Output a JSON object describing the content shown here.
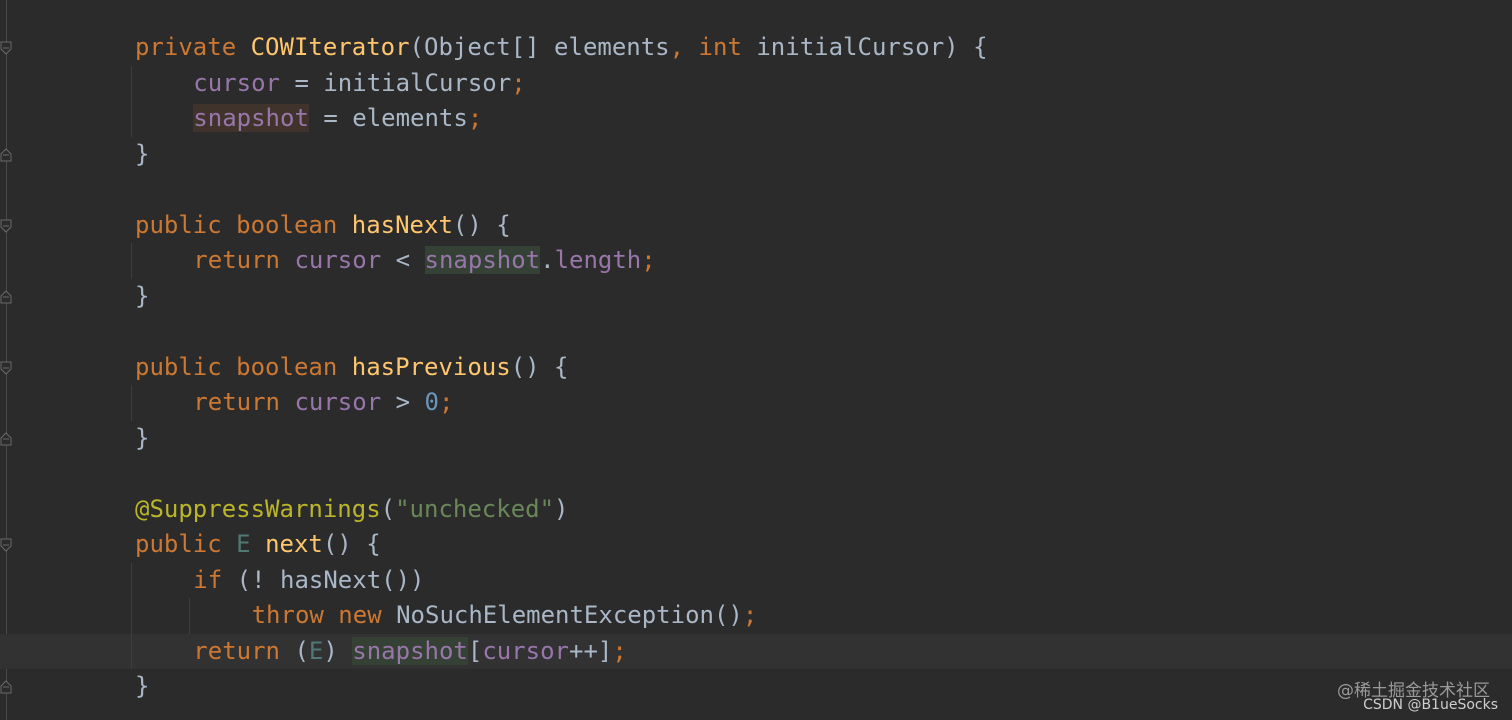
{
  "editor": {
    "lines": [
      {
        "indent": 0,
        "tokens": [
          {
            "t": "private ",
            "c": "kw"
          },
          {
            "t": "COWIterator",
            "c": "fn"
          },
          {
            "t": "(Object[] elements",
            "c": ""
          },
          {
            "t": ", ",
            "c": "kw"
          },
          {
            "t": "int ",
            "c": "kw"
          },
          {
            "t": "initialCursor) {",
            "c": ""
          }
        ]
      },
      {
        "indent": 1,
        "tokens": [
          {
            "t": "cursor",
            "c": "field"
          },
          {
            "t": " = initialCursor",
            "c": ""
          },
          {
            "t": ";",
            "c": "kw"
          }
        ]
      },
      {
        "indent": 1,
        "tokens": [
          {
            "t": "snapshot",
            "c": "field hl-write"
          },
          {
            "t": " = elements",
            "c": ""
          },
          {
            "t": ";",
            "c": "kw"
          }
        ]
      },
      {
        "indent": 0,
        "tokens": [
          {
            "t": "}",
            "c": ""
          }
        ]
      },
      {
        "indent": 0,
        "tokens": []
      },
      {
        "indent": 0,
        "tokens": [
          {
            "t": "public ",
            "c": "kw"
          },
          {
            "t": "boolean ",
            "c": "kw"
          },
          {
            "t": "hasNext",
            "c": "fn"
          },
          {
            "t": "() {",
            "c": ""
          }
        ]
      },
      {
        "indent": 1,
        "tokens": [
          {
            "t": "return ",
            "c": "kw"
          },
          {
            "t": "cursor",
            "c": "field"
          },
          {
            "t": " < ",
            "c": ""
          },
          {
            "t": "snapshot",
            "c": "field hl-read"
          },
          {
            "t": ".",
            "c": ""
          },
          {
            "t": "length",
            "c": "field"
          },
          {
            "t": ";",
            "c": "kw"
          }
        ]
      },
      {
        "indent": 0,
        "tokens": [
          {
            "t": "}",
            "c": ""
          }
        ]
      },
      {
        "indent": 0,
        "tokens": []
      },
      {
        "indent": 0,
        "tokens": [
          {
            "t": "public ",
            "c": "kw"
          },
          {
            "t": "boolean ",
            "c": "kw"
          },
          {
            "t": "hasPrevious",
            "c": "fn"
          },
          {
            "t": "() {",
            "c": ""
          }
        ]
      },
      {
        "indent": 1,
        "tokens": [
          {
            "t": "return ",
            "c": "kw"
          },
          {
            "t": "cursor",
            "c": "field"
          },
          {
            "t": " > ",
            "c": ""
          },
          {
            "t": "0",
            "c": "num"
          },
          {
            "t": ";",
            "c": "kw"
          }
        ]
      },
      {
        "indent": 0,
        "tokens": [
          {
            "t": "}",
            "c": ""
          }
        ]
      },
      {
        "indent": 0,
        "tokens": []
      },
      {
        "indent": 0,
        "tokens": [
          {
            "t": "@SuppressWarnings",
            "c": "ann"
          },
          {
            "t": "(",
            "c": ""
          },
          {
            "t": "\"unchecked\"",
            "c": "str"
          },
          {
            "t": ")",
            "c": ""
          }
        ]
      },
      {
        "indent": 0,
        "tokens": [
          {
            "t": "public ",
            "c": "kw"
          },
          {
            "t": "E",
            "c": "tparam"
          },
          {
            "t": " ",
            "c": ""
          },
          {
            "t": "next",
            "c": "fn"
          },
          {
            "t": "() {",
            "c": ""
          }
        ]
      },
      {
        "indent": 1,
        "tokens": [
          {
            "t": "if ",
            "c": "kw"
          },
          {
            "t": "(! hasNext())",
            "c": ""
          }
        ]
      },
      {
        "indent": 2,
        "tokens": [
          {
            "t": "throw new ",
            "c": "kw"
          },
          {
            "t": "NoSuchElementException()",
            "c": ""
          },
          {
            "t": ";",
            "c": "kw"
          }
        ]
      },
      {
        "indent": 1,
        "caret": true,
        "tokens": [
          {
            "t": "return ",
            "c": "kw"
          },
          {
            "t": "(",
            "c": ""
          },
          {
            "t": "E",
            "c": "tparam"
          },
          {
            "t": ") ",
            "c": ""
          },
          {
            "t": "snapshot",
            "c": "field hl-read"
          },
          {
            "t": "[",
            "c": ""
          },
          {
            "t": "cursor",
            "c": "field"
          },
          {
            "t": "++]",
            "c": ""
          },
          {
            "t": ";",
            "c": "kw"
          }
        ]
      },
      {
        "indent": 0,
        "tokens": [
          {
            "t": "}",
            "c": ""
          }
        ]
      }
    ]
  },
  "watermark": {
    "line1": "@稀土掘金技术社区",
    "line2": "CSDN @B1ueSocks"
  },
  "colors": {
    "background": "#2b2b2b",
    "keyword": "#cc7832",
    "function": "#ffc66d",
    "field": "#9876aa",
    "text": "#a9b7c6",
    "string": "#6a8759",
    "annotation": "#bbb529",
    "number": "#6897bb"
  },
  "icons": [
    "fold-start-icon",
    "fold-end-icon"
  ]
}
